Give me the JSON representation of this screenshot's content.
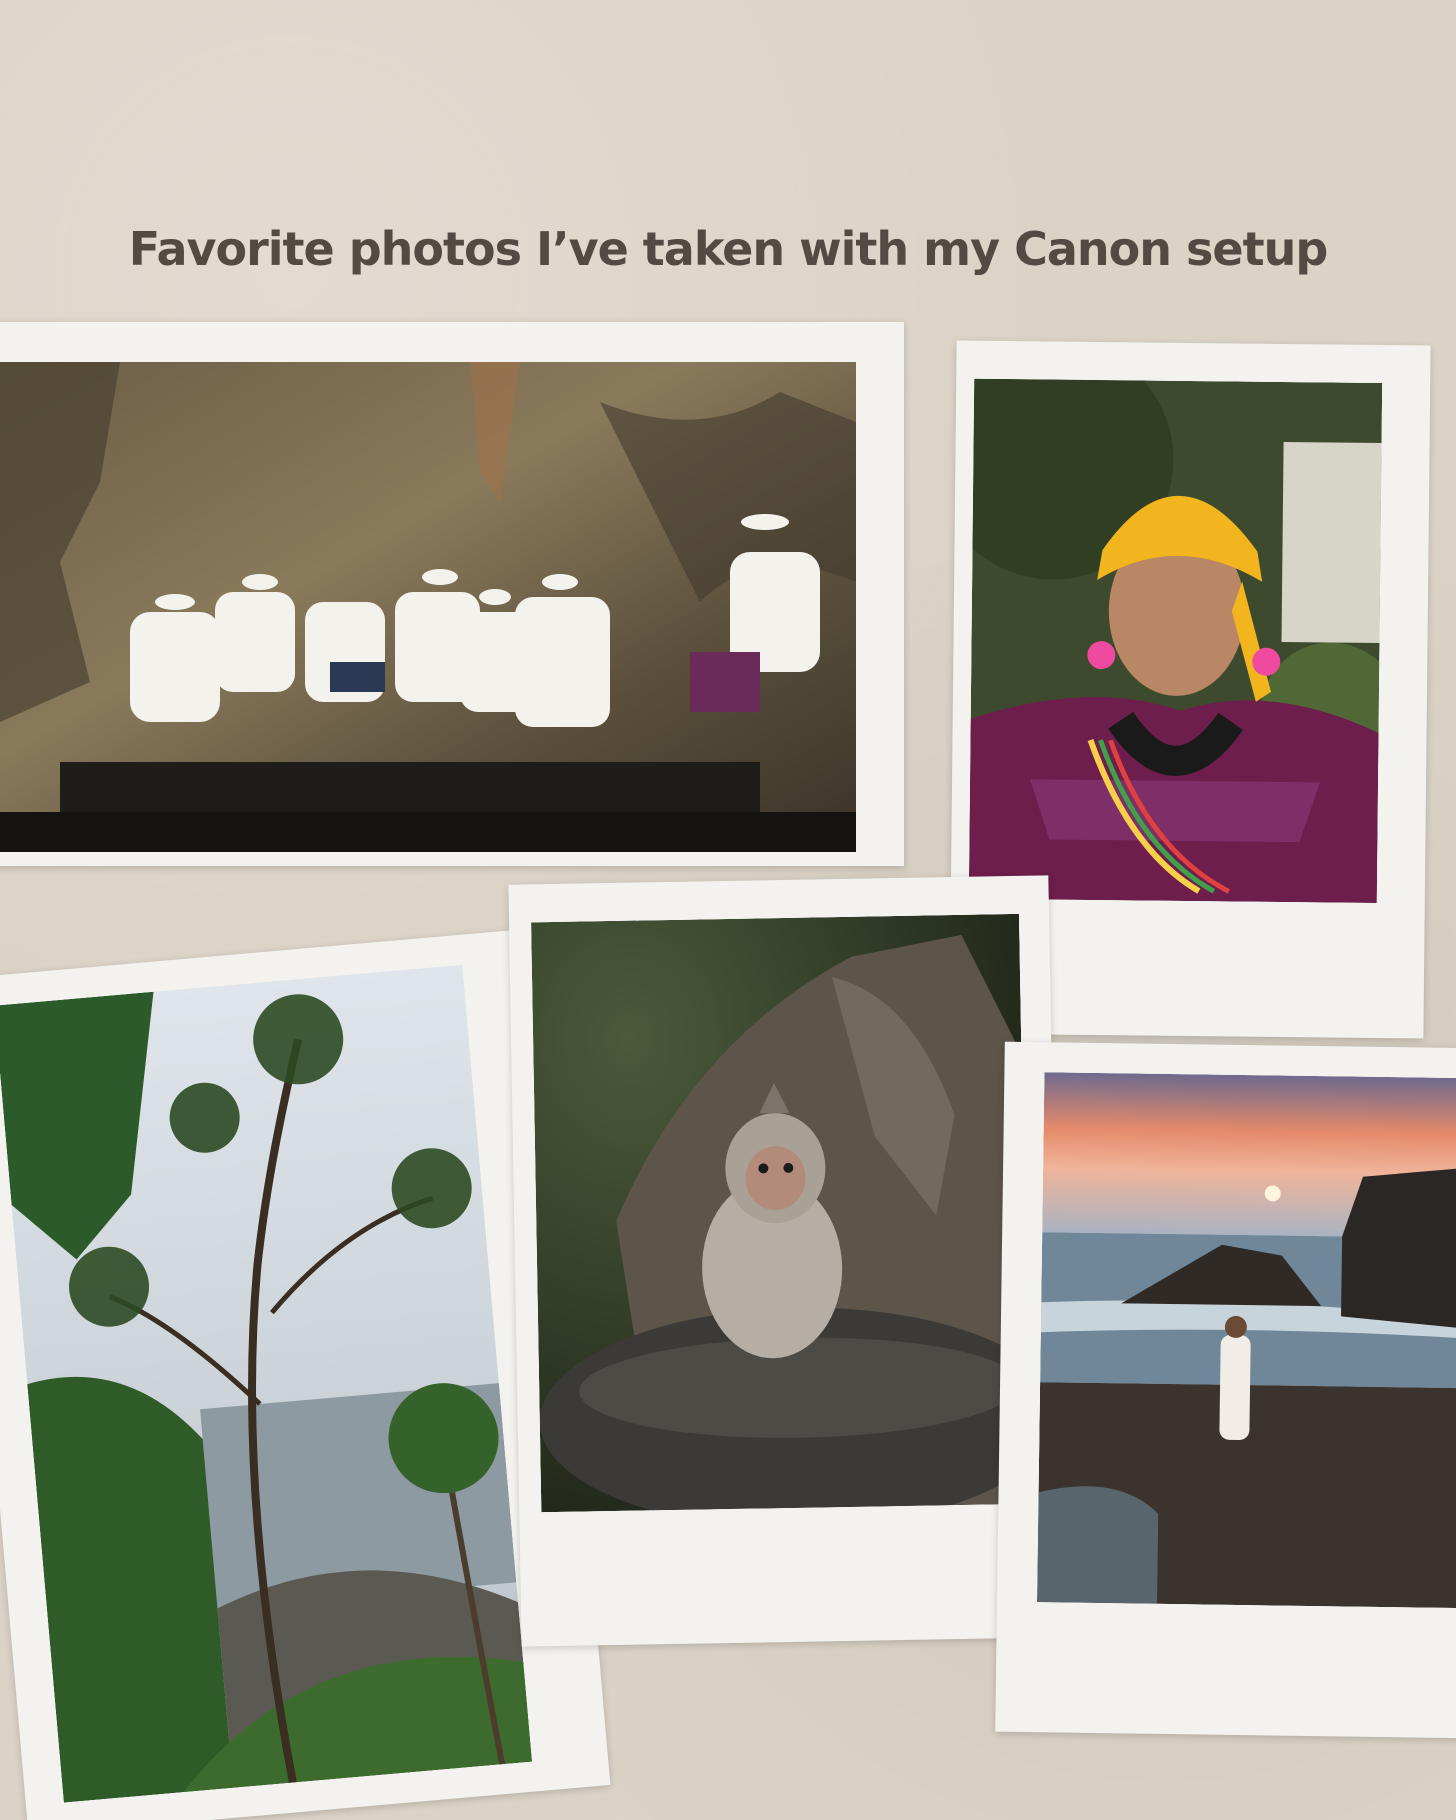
{
  "header": {
    "title": "Favorite photos I’ve taken with my Canon setup"
  }
}
